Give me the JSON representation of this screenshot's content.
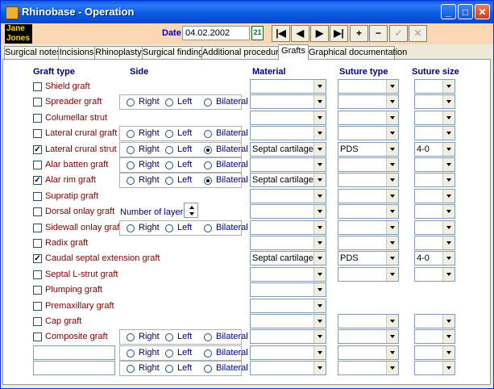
{
  "window": {
    "title": "Rhinobase  -  Operation",
    "min": "_",
    "max": "□",
    "close": "✕"
  },
  "patient": {
    "first": "Jane",
    "last": "Jones"
  },
  "date": {
    "label": "Date",
    "value": "04.02.2002"
  },
  "nav": [
    "|◀",
    "◀",
    "▶",
    "▶|",
    "+",
    "−",
    "✓",
    "✕"
  ],
  "tabs": [
    "Surgical notes",
    "Incisions",
    "Rhinoplasty",
    "Surgical findings",
    "Additional procedures",
    "Grafts",
    "Graphical documentation"
  ],
  "active_tab": 5,
  "columns": {
    "graft_type": "Graft type",
    "side": "Side",
    "material": "Material",
    "suture_type": "Suture type",
    "suture_size": "Suture size"
  },
  "side_options": {
    "right": "Right",
    "left": "Left",
    "bilateral": "Bilateral"
  },
  "layers_label": "Number of layers",
  "rows": [
    {
      "name": "Shield graft",
      "checked": false,
      "side": null,
      "material": "",
      "suture": "",
      "size": ""
    },
    {
      "name": "Spreader graft",
      "checked": false,
      "side": "",
      "material": "",
      "suture": "",
      "size": ""
    },
    {
      "name": "Columellar strut",
      "checked": false,
      "side": null,
      "material": "",
      "suture": "",
      "size": ""
    },
    {
      "name": "Lateral crural graft",
      "checked": false,
      "side": "",
      "material": "",
      "suture": "",
      "size": ""
    },
    {
      "name": "Lateral crural strut graft",
      "checked": true,
      "side": "bilateral",
      "material": "Septal cartilage",
      "suture": "PDS",
      "size": "4-0"
    },
    {
      "name": "Alar batten graft",
      "checked": false,
      "side": "",
      "material": "",
      "suture": "",
      "size": ""
    },
    {
      "name": "Alar rim graft",
      "checked": true,
      "side": "bilateral",
      "material": "Septal cartilage",
      "suture": "",
      "size": ""
    },
    {
      "name": "Supratip graft",
      "checked": false,
      "side": null,
      "material": "",
      "suture": "",
      "size": ""
    },
    {
      "name": "Dorsal onlay graft",
      "checked": false,
      "side": null,
      "material": "",
      "suture": "",
      "size": ""
    },
    {
      "name": "Sidewall onlay graft",
      "checked": false,
      "side": "",
      "material": "",
      "suture": "",
      "size": ""
    },
    {
      "name": "Radix graft",
      "checked": false,
      "side": null,
      "material": "",
      "suture": "",
      "size": ""
    },
    {
      "name": "Caudal septal extension graft",
      "checked": true,
      "side": null,
      "material": "Septal cartilage",
      "suture": "PDS",
      "size": "4-0"
    },
    {
      "name": "Septal L-strut graft",
      "checked": false,
      "side": null,
      "material": "",
      "suture": "",
      "size": ""
    },
    {
      "name": "Plumping graft",
      "checked": false,
      "side": null,
      "material": "",
      "suture": null,
      "size": null
    },
    {
      "name": "Premaxillary graft",
      "checked": false,
      "side": null,
      "material": "",
      "suture": null,
      "size": null
    },
    {
      "name": "Cap graft",
      "checked": false,
      "side": null,
      "material": "",
      "suture": "",
      "size": ""
    },
    {
      "name": "Composite graft",
      "checked": false,
      "side": "",
      "material": "",
      "suture": "",
      "size": ""
    },
    {
      "name": "",
      "custom": true,
      "side": "",
      "material": "",
      "suture": "",
      "size": ""
    },
    {
      "name": "",
      "custom": true,
      "side": "",
      "material": "",
      "suture": "",
      "size": ""
    }
  ],
  "colors": {
    "title_blue": "#0a5ae6",
    "header_peach": "#fcd7b6",
    "label_maroon": "#800000",
    "label_navy": "#000080"
  }
}
